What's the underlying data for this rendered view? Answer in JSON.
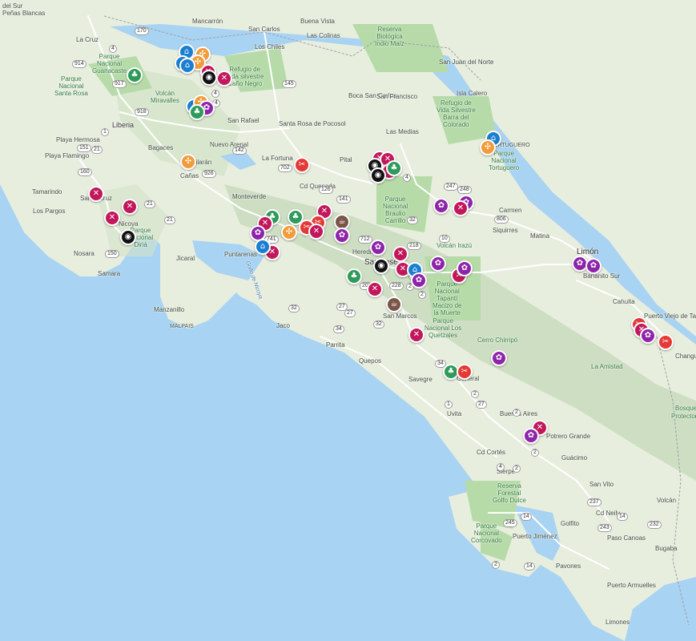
{
  "map": {
    "region": "Costa Rica",
    "colors": {
      "sea": "#a9d3f2",
      "land": "#e8eede",
      "mountain": "#c7d9bc",
      "park": "#b6dba8",
      "road": "#ffffff",
      "restaurant": "#c2185b",
      "art": "#8e24aa",
      "nature": "#2e9b5a",
      "adventure": "#f29b38",
      "lodging": "#1a7fd1",
      "coffee": "#795548",
      "shopping": "#e53935",
      "other": "#111111"
    },
    "labels": {
      "penas_blancas": "Peñas Blancas",
      "del_sur": "del Sur",
      "mancarron": "Mancarrón",
      "san_carlos": "San Carlos",
      "buena_vista": "Buena Vista",
      "las_colinas": "Las Colinas",
      "los_chiles": "Los Chiles",
      "reserva_indio_maiz": "Reserva\nBiológica\nIndio Maíz",
      "la_cruz": "La Cruz",
      "pn_guanacaste": "Parque\nNacional\nGuanacaste",
      "refugio_cano_negro": "Refugio de\nVida silvestre\nCaño Negro",
      "san_juan_del_norte": "San Juan\ndel Norte",
      "pn_santa_rosa": "Parque\nNacional\nSanta Rosa",
      "volcan_miravalles": "Volcán\nMiravalles",
      "isla_calero": "Isla Calero",
      "boca_san_carlos": "Boca San\nCarlos",
      "san_francisco": "San Francisco",
      "refugio_barra_colorado": "Refugio de\nVida Silvestre\nBarra del\nColorado",
      "liberia": "Liberia",
      "san_rafael": "San Rafael",
      "santa_rosa_pocosol": "Santa Rosa\nde Pocosol",
      "las_medias": "Las Medias",
      "playa_hermosa": "Playa Hermosa",
      "playa_flamingo": "Playa\nFlamingo",
      "bagaces": "Bagaces",
      "nuevo_arenal": "Nuevo Arenal",
      "tortuguero_town": "TORTUGUERO",
      "pn_tortuguero": "Parque\nNacional\nTortuguero",
      "la_fortuna": "La Fortuna",
      "pital": "Pital",
      "tamarindo": "Tamarindo",
      "canas": "Cañas",
      "tilaran": "Tilarán",
      "cd_quesada": "Cd Quesada",
      "los_pargos": "Los Pargos",
      "santa_cruz": "Santa Cruz",
      "monteverde": "Monteverde",
      "pn_braulio_carrillo": "Parque\nNacional\nBraulio\nCarrillo",
      "carmen": "Carmen",
      "nicoya": "Nicoya",
      "pn_diria": "Parque\nNacional\nDiriá",
      "volcan_irazu": "Volcán Irazú",
      "siquirres": "Siquirres",
      "matina": "Matina",
      "nosara": "Nosara",
      "puntarenas": "Puntarenas",
      "jicaral": "Jicaral",
      "heredia": "Heredia",
      "san_jose": "San José",
      "limon": "Limón",
      "banano_sur": "Bananito Sur",
      "samara": "Samara",
      "golfo_nicoya": "Golfo de Nicoya",
      "tapanti": "Parque\nNacional\nTapantí\nMacizo de\nla Muerte",
      "manzanillo": "Manzanillo",
      "malpais": "MALPAIS",
      "jaco": "Jaco",
      "san_marcos": "San Marcos",
      "pn_los_quetzales": "Parque\nNacional Los\nQuetzales",
      "cahuita": "Cahuita",
      "puerto_viejo": "Puerto Viejo\nde Talamanca",
      "parrita": "Parrita",
      "la_amistad": "La Amistad",
      "changuinola": "Changui",
      "cerro_chirripo": "Cerro Chirripó",
      "quepos": "Quepos",
      "savegre": "Savegre",
      "general": "General",
      "bosque": "Bosque",
      "protector": "Protector",
      "uvita": "Uvita",
      "buenos_aires": "Buenos Aires",
      "potrero_grande": "Potrero\nGrande",
      "cd_cortes": "Cd Cortés",
      "guacimo": "Guácimo",
      "san_vito": "San Vito",
      "volcan": "Volcán",
      "sierpe": "Sierpe",
      "golfo_dulce": "Reserva\nForestal\nGolfo Dulce",
      "cd_neily": "Cd Neily",
      "pn_corcovado": "Parque\nNacional\nCorcovado",
      "puerto_jimenez": "Puerto Jiménez",
      "golfito": "Golfito",
      "paso_canoas": "Paso Canoas",
      "bugaba": "Bugaba",
      "pavones": "Pavones",
      "puerto_armuelles": "Puerto\nArmuelles",
      "limones": "Limones"
    },
    "road_numbers": [
      "170",
      "4",
      "918",
      "917",
      "914",
      "21",
      "1",
      "160",
      "151",
      "150",
      "21",
      "21",
      "926",
      "142",
      "145",
      "702",
      "741",
      "4",
      "32",
      "126",
      "141",
      "712",
      "218",
      "4",
      "247",
      "248",
      "806",
      "2",
      "2",
      "10",
      "34",
      "2",
      "27",
      "2",
      "4",
      "2",
      "14",
      "27",
      "32",
      "209",
      "228",
      "2",
      "27",
      "32",
      "34",
      "2",
      "2",
      "237",
      "243",
      "245",
      "14",
      "14",
      "232",
      "1",
      "35",
      "4"
    ]
  }
}
